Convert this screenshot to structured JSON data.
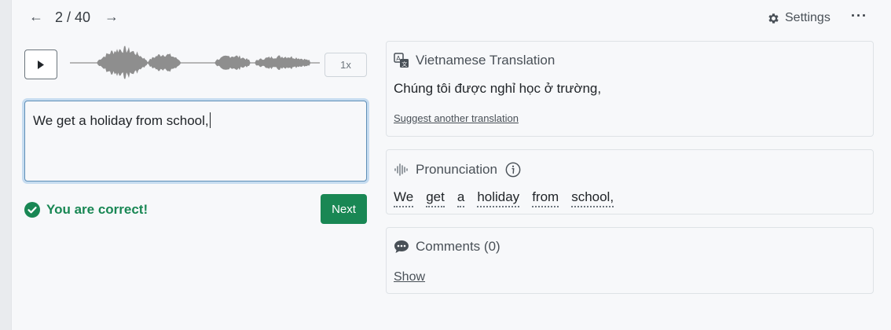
{
  "nav": {
    "prev_icon": "arrow-left-icon",
    "next_icon": "arrow-right-icon",
    "counter": "2 / 40",
    "settings_label": "Settings",
    "more_label": "···"
  },
  "audio": {
    "play_icon": "play-icon",
    "speed": "1x"
  },
  "answer": {
    "value": "We get a holiday from school,"
  },
  "result": {
    "message": "You are correct!",
    "next_label": "Next",
    "color": "#198754"
  },
  "translation": {
    "title": "Vietnamese Translation",
    "text": "Chúng tôi được nghỉ học ở trường,",
    "suggest_link": "Suggest another translation"
  },
  "pronunciation": {
    "title": "Pronunciation",
    "words": [
      "We",
      "get",
      "a",
      "holiday",
      "from",
      "school,"
    ]
  },
  "comments": {
    "title": "Comments (0)",
    "show_link": "Show"
  },
  "colors": {
    "accent_green": "#198754",
    "focus_ring": "#c6dcf0",
    "waveform": "#8e8e8e"
  }
}
